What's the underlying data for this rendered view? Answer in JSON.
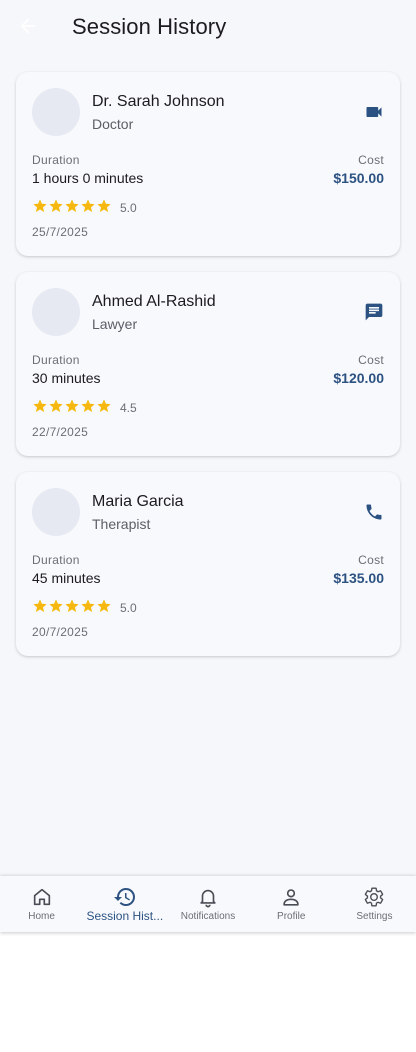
{
  "app_bar": {
    "title": "Session History",
    "back_icon": "arrow-back-icon"
  },
  "sessions": [
    {
      "name": "Dr. Sarah Johnson",
      "role": "Doctor",
      "type_icon": "videocam-icon",
      "duration_label": "Duration",
      "duration": "1 hours 0 minutes",
      "cost_label": "Cost",
      "cost": "$150.00",
      "stars": 5,
      "rating": "5.0",
      "date": "25/7/2025"
    },
    {
      "name": "Ahmed Al-Rashid",
      "role": "Lawyer",
      "type_icon": "chat-icon",
      "duration_label": "Duration",
      "duration": "30 minutes",
      "cost_label": "Cost",
      "cost": "$120.00",
      "stars": 4.5,
      "rating": "4.5",
      "date": "22/7/2025"
    },
    {
      "name": "Maria Garcia",
      "role": "Therapist",
      "type_icon": "phone-icon",
      "duration_label": "Duration",
      "duration": "45 minutes",
      "cost_label": "Cost",
      "cost": "$135.00",
      "stars": 5,
      "rating": "5.0",
      "date": "20/7/2025"
    }
  ],
  "bottom_nav": {
    "items": [
      {
        "label": "Home",
        "icon": "home-icon",
        "active": false
      },
      {
        "label": "Session Hist...",
        "icon": "history-icon",
        "active": true
      },
      {
        "label": "Notifications",
        "icon": "bell-icon",
        "active": false
      },
      {
        "label": "Profile",
        "icon": "person-icon",
        "active": false
      },
      {
        "label": "Settings",
        "icon": "gear-icon",
        "active": false
      }
    ]
  },
  "colors": {
    "accent": "#2c5282",
    "star": "#f5b80f",
    "background": "#f6f7fb",
    "card": "#f8f9fd",
    "back_icon": "#ffffff"
  }
}
